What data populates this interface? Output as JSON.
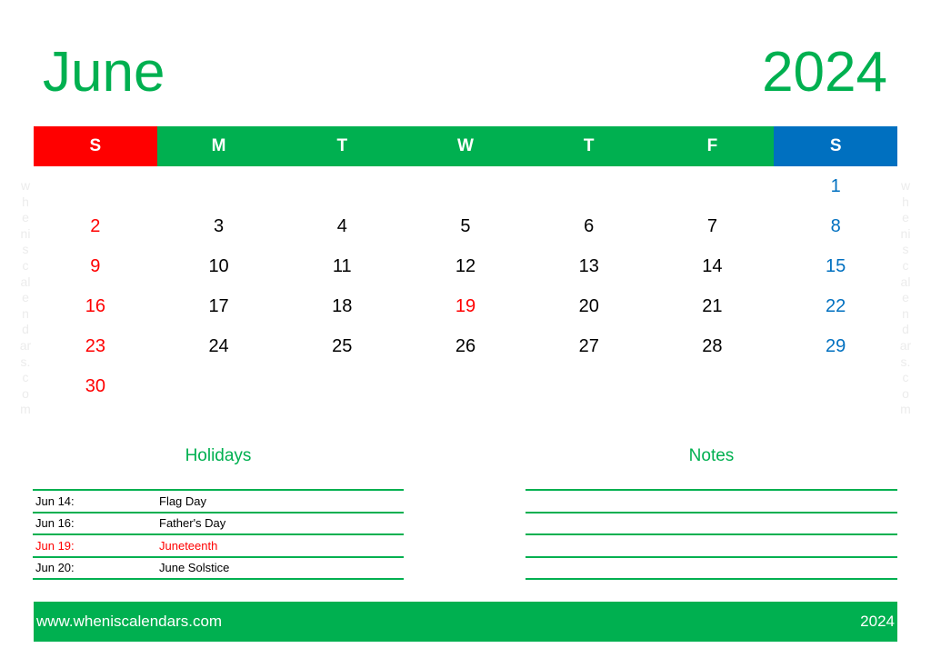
{
  "header": {
    "month": "June",
    "year": "2024"
  },
  "weekdays": [
    "S",
    "M",
    "T",
    "W",
    "T",
    "F",
    "S"
  ],
  "colors": {
    "accent_green": "#00b050",
    "sunday_red": "#ff0000",
    "saturday_blue": "#0070c0",
    "holiday_red": "#ff0000"
  },
  "calendar": {
    "leading_blanks": 6,
    "days": [
      "1",
      "2",
      "3",
      "4",
      "5",
      "6",
      "7",
      "8",
      "9",
      "10",
      "11",
      "12",
      "13",
      "14",
      "15",
      "16",
      "17",
      "18",
      "19",
      "20",
      "21",
      "22",
      "23",
      "24",
      "25",
      "26",
      "27",
      "28",
      "29",
      "30"
    ],
    "highlighted_days": [
      "19"
    ]
  },
  "watermark": [
    "w",
    "h",
    "e",
    "ni",
    "s",
    "c",
    "al",
    "e",
    "n",
    "d",
    "ar",
    "s.",
    "c",
    "o",
    "m"
  ],
  "holidays": {
    "title": "Holidays",
    "items": [
      {
        "date": "Jun 14:",
        "name": "Flag Day",
        "highlight": false
      },
      {
        "date": "Jun 16:",
        "name": "Father's Day",
        "highlight": false
      },
      {
        "date": "Jun 19:",
        "name": "Juneteenth",
        "highlight": true
      },
      {
        "date": "Jun 20:",
        "name": "June Solstice",
        "highlight": false
      }
    ]
  },
  "notes": {
    "title": "Notes",
    "line_count": 4
  },
  "footer": {
    "website": "www.wheniscalendars.com",
    "year": "2024"
  }
}
